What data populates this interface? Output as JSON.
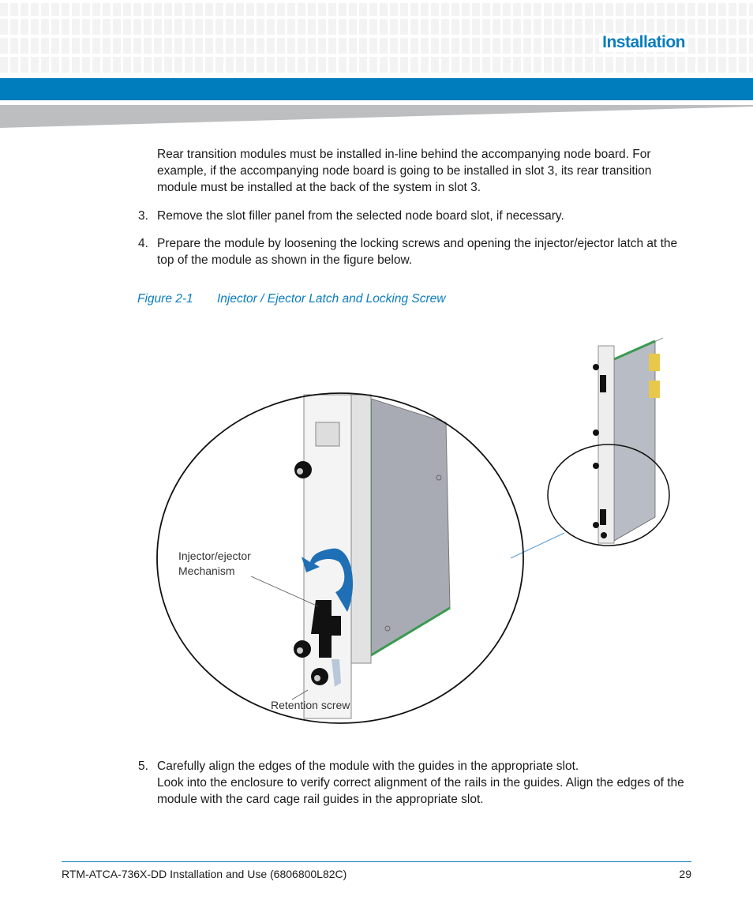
{
  "header": {
    "section_title": "Installation",
    "accent_color": "#007dbd"
  },
  "body": {
    "intro": "Rear transition modules must be installed in-line behind the accompanying node board. For example, if the accompanying node board is going to be installed in slot 3, its rear transition module must be installed at the back of the system in slot 3.",
    "steps": [
      {
        "num": "3.",
        "text": "Remove the slot filler panel from the selected node board slot, if necessary."
      },
      {
        "num": "4.",
        "text": "Prepare the module by loosening the locking screws and opening the injector/ejector latch at the top of the module as shown in the figure below."
      },
      {
        "num": "5.",
        "text": "Carefully align the edges of the module with the guides in the appropriate slot.",
        "subtext": "Look into the enclosure to verify correct alignment of the rails in the guides. Align the edges of the module with the card cage rail guides in the appropriate slot."
      }
    ]
  },
  "figure": {
    "label": "Figure 2-1",
    "title": "Injector / Ejector Latch and Locking Screw",
    "callout_mechanism_1": "Injector/ejector",
    "callout_mechanism_2": "Mechanism",
    "callout_screw": "Retention screw"
  },
  "footer": {
    "doc_title": "RTM-ATCA-736X-DD Installation and Use (6806800L82C)",
    "page_number": "29"
  }
}
